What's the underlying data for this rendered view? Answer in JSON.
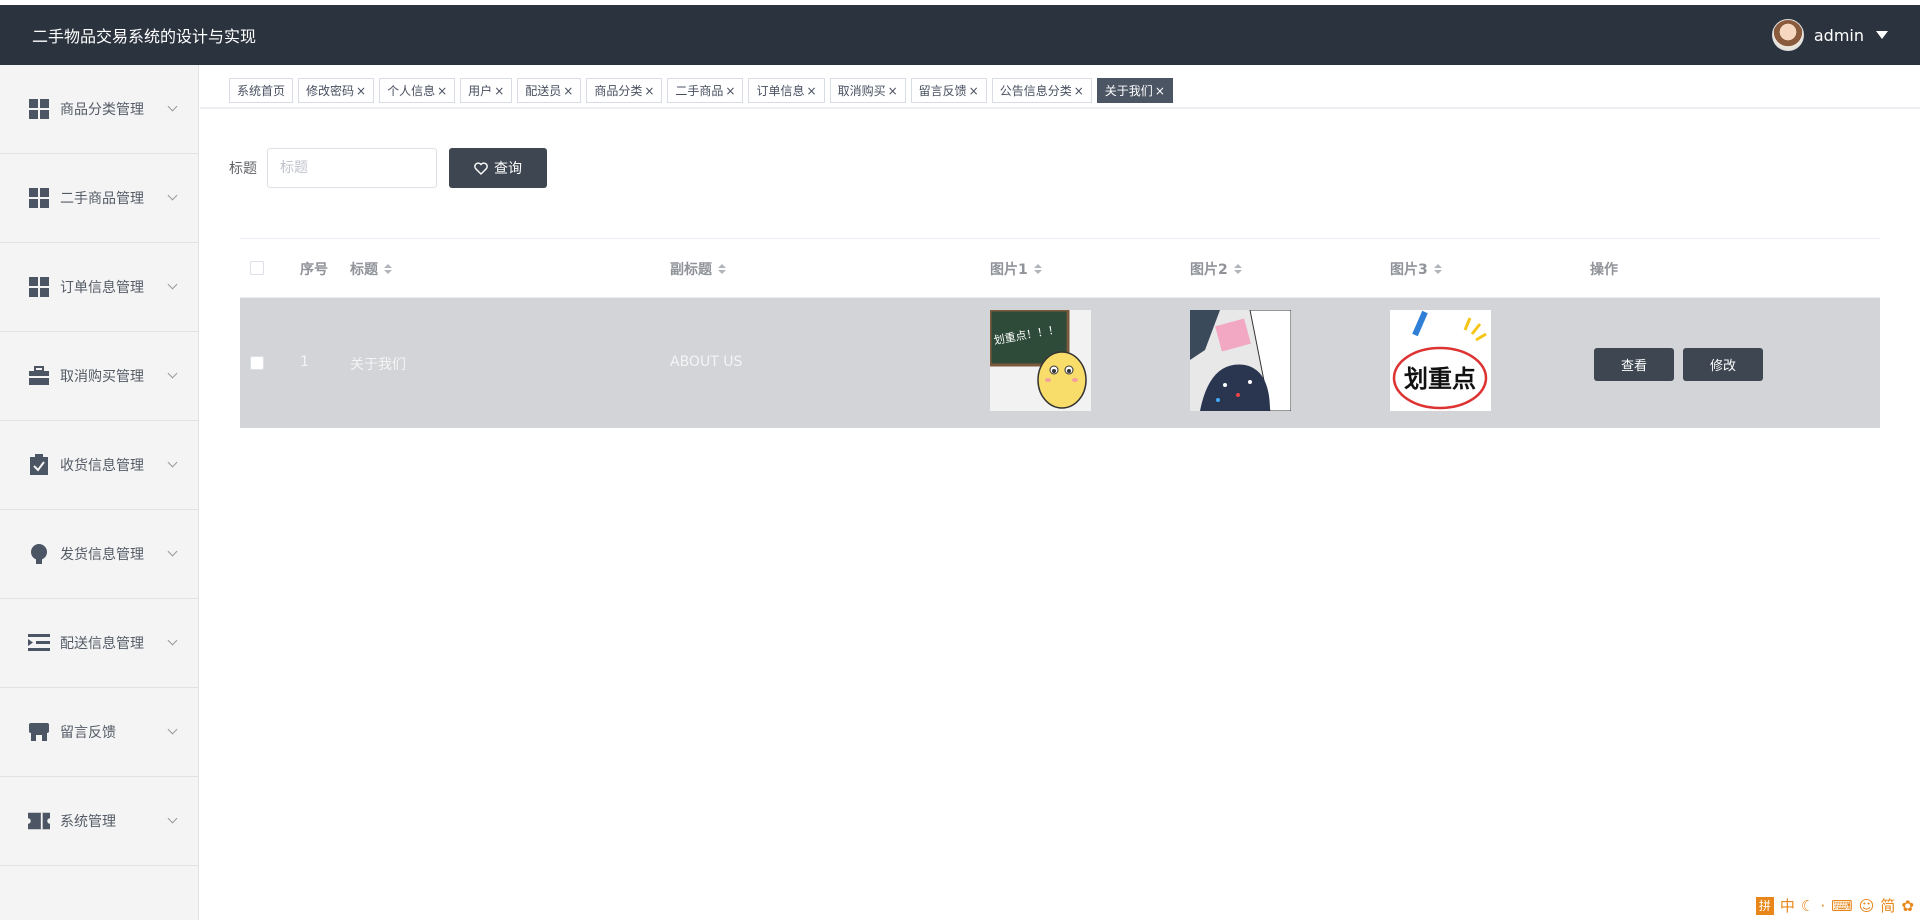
{
  "header": {
    "title": "二手物品交易系统的设计与实现",
    "username": "admin"
  },
  "sidebar": {
    "items": [
      {
        "label": "商品分类管理",
        "icon": "grid-icon"
      },
      {
        "label": "二手商品管理",
        "icon": "grid-icon"
      },
      {
        "label": "订单信息管理",
        "icon": "grid-icon"
      },
      {
        "label": "取消购买管理",
        "icon": "briefcase-icon"
      },
      {
        "label": "收货信息管理",
        "icon": "clipboard-check-icon"
      },
      {
        "label": "发货信息管理",
        "icon": "lightbulb-icon"
      },
      {
        "label": "配送信息管理",
        "icon": "indent-list-icon"
      },
      {
        "label": "留言反馈",
        "icon": "store-icon"
      },
      {
        "label": "系统管理",
        "icon": "ticket-icon"
      }
    ]
  },
  "tabs": [
    {
      "label": "系统首页",
      "closable": false
    },
    {
      "label": "修改密码",
      "closable": true
    },
    {
      "label": "个人信息",
      "closable": true
    },
    {
      "label": "用户",
      "closable": true
    },
    {
      "label": "配送员",
      "closable": true
    },
    {
      "label": "商品分类",
      "closable": true
    },
    {
      "label": "二手商品",
      "closable": true
    },
    {
      "label": "订单信息",
      "closable": true
    },
    {
      "label": "取消购买",
      "closable": true
    },
    {
      "label": "留言反馈",
      "closable": true
    },
    {
      "label": "公告信息分类",
      "closable": true
    },
    {
      "label": "关于我们",
      "closable": true,
      "active": true
    }
  ],
  "search": {
    "label": "标题",
    "placeholder": "标题",
    "button_label": "查询"
  },
  "table": {
    "columns": [
      "序号",
      "标题",
      "副标题",
      "图片1",
      "图片2",
      "图片3",
      "操作"
    ],
    "rows": [
      {
        "index": "1",
        "title": "关于我们",
        "subtitle": "ABOUT US",
        "image3_text": "划重点",
        "image1_text": "划重点！！！",
        "view_label": "查看",
        "edit_label": "修改"
      }
    ]
  },
  "ime": {
    "items": [
      "拼",
      "中",
      "·",
      "简"
    ]
  },
  "colors": {
    "topbar": "#2b333e",
    "button": "#3e4651",
    "row_hover": "#d2d4d7",
    "active_tab": "#4b5563"
  }
}
